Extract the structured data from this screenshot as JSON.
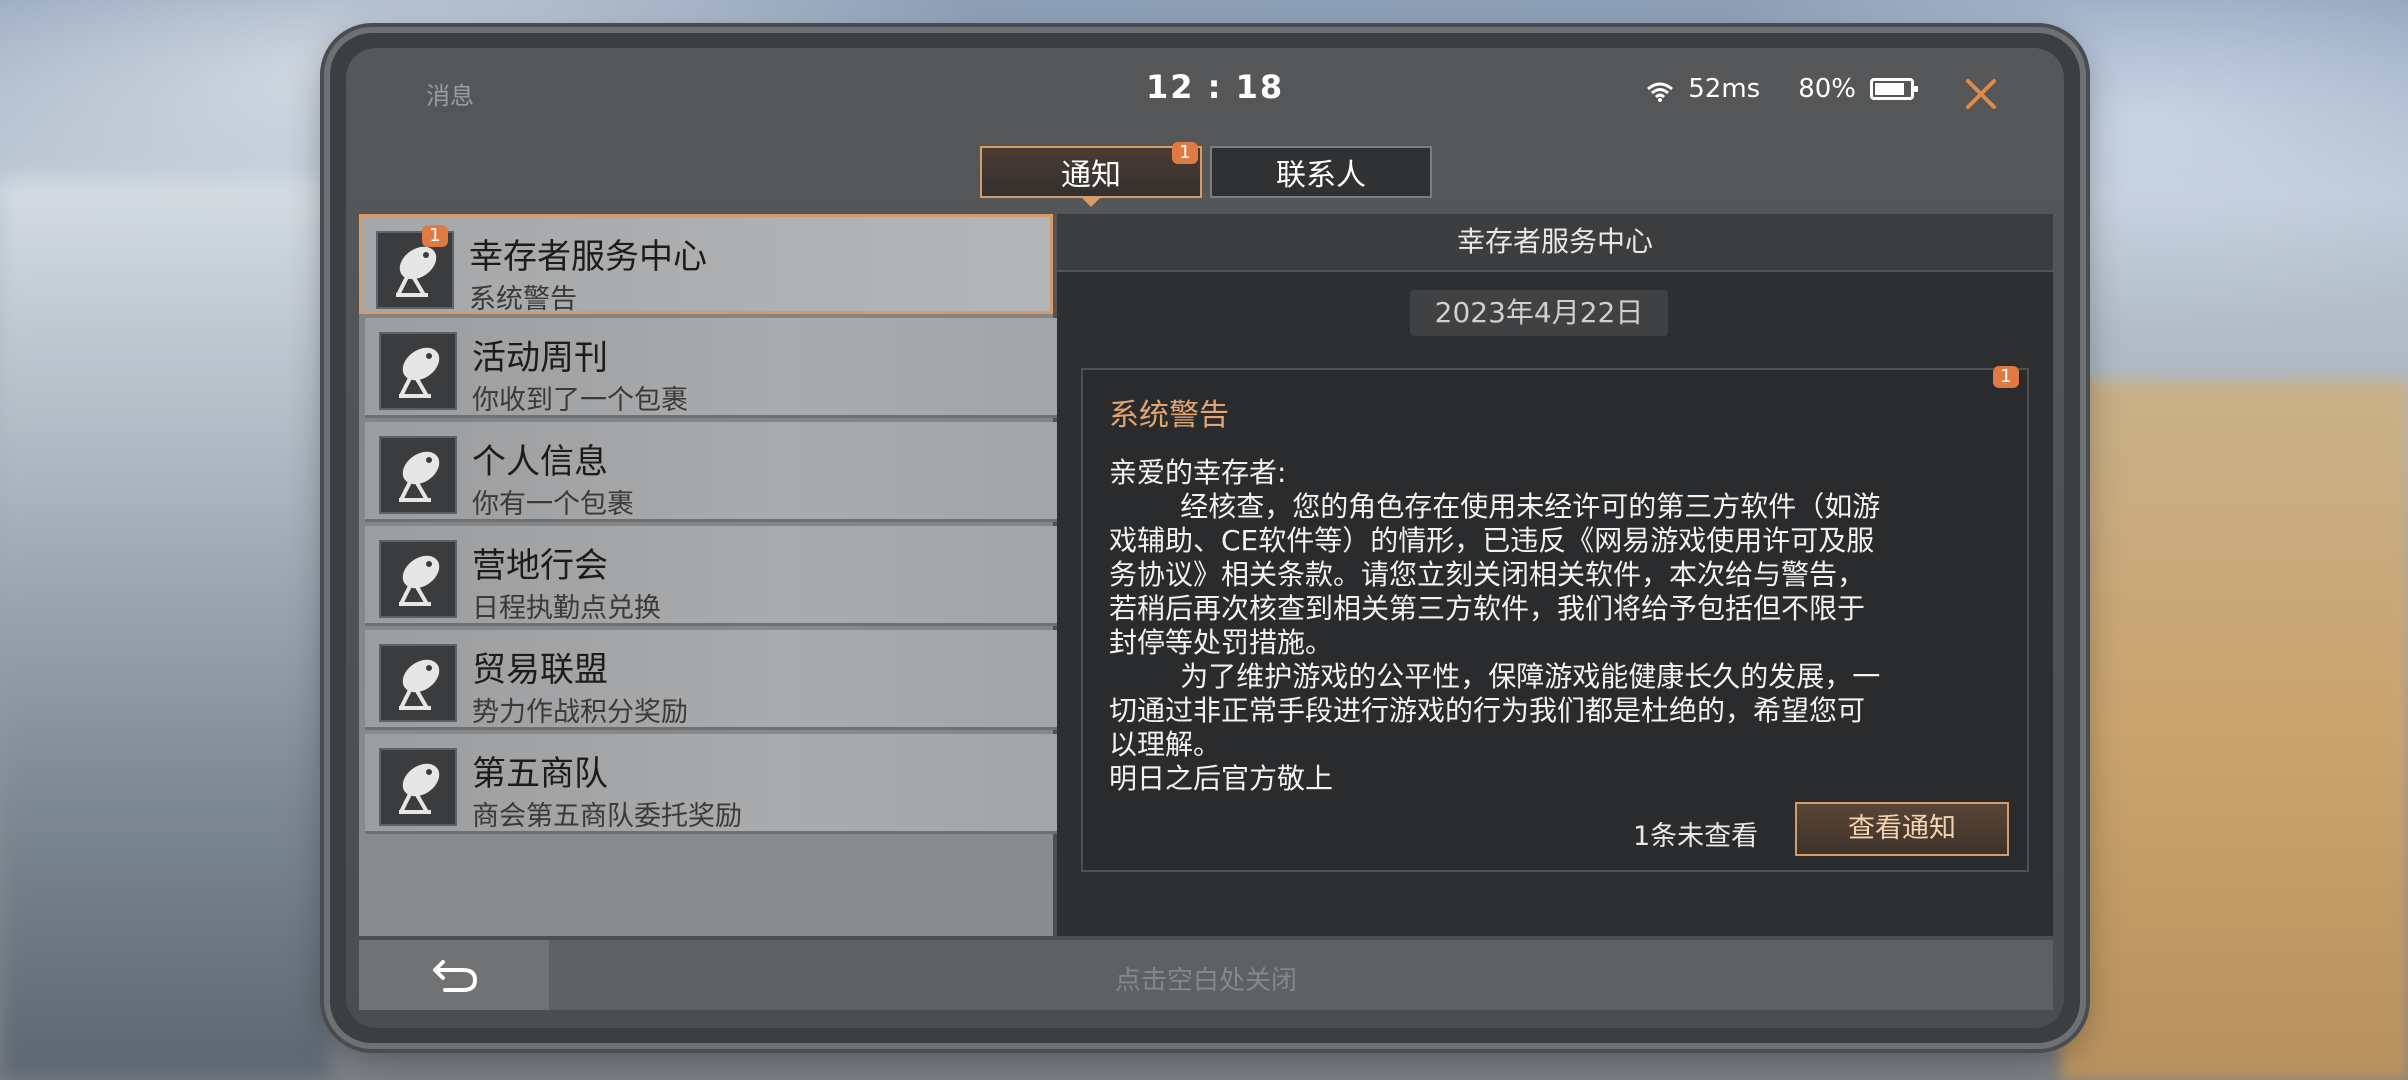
{
  "status_bar": {
    "title": "消息",
    "time": "12 : 18",
    "ping": "52ms",
    "battery": "80%",
    "battery_level": 0.8
  },
  "tabs": [
    {
      "label": "通知",
      "badge": "1",
      "active": true
    },
    {
      "label": "联系人",
      "active": false
    }
  ],
  "list": [
    {
      "title": "幸存者服务中心",
      "subtitle": "系统警告",
      "badge": "1",
      "selected": true
    },
    {
      "title": "活动周刊",
      "subtitle": "你收到了一个包裹"
    },
    {
      "title": "个人信息",
      "subtitle": "你有一个包裹"
    },
    {
      "title": "营地行会",
      "subtitle": "日程执勤点兑换"
    },
    {
      "title": "贸易联盟",
      "subtitle": "势力作战积分奖励"
    },
    {
      "title": "第五商队",
      "subtitle": "商会第五商队委托奖励"
    }
  ],
  "detail": {
    "header": "幸存者服务中心",
    "date": "2023年4月22日",
    "card_badge": "1",
    "message_title": "系统警告",
    "message_body": "亲爱的幸存者:\n        经核查，您的角色存在使用未经许可的第三方软件（如游\n戏辅助、CE软件等）的情形，已违反《网易游戏使用许可及服\n务协议》相关条款。请您立刻关闭相关软件，本次给与警告，\n若稍后再次核查到相关第三方软件，我们将给予包括但不限于\n封停等处罚措施。\n        为了维护游戏的公平性，保障游戏能健康长久的发展，一\n切通过非正常手段进行游戏的行为我们都是杜绝的，希望您可\n以理解。\n明日之后官方敬上",
    "unread_text": "1条未查看",
    "view_button": "查看通知"
  },
  "bottom": {
    "hint": "点击空白处关闭"
  },
  "colors": {
    "accent": "#d79b68",
    "badge": "#e07a44",
    "title_accent": "#e2a56f"
  },
  "icons": {
    "close": "close-icon",
    "wifi": "wifi-icon",
    "battery": "battery-icon",
    "list_icon": "satellite-dish-icon",
    "back": "back-arrow-icon"
  }
}
